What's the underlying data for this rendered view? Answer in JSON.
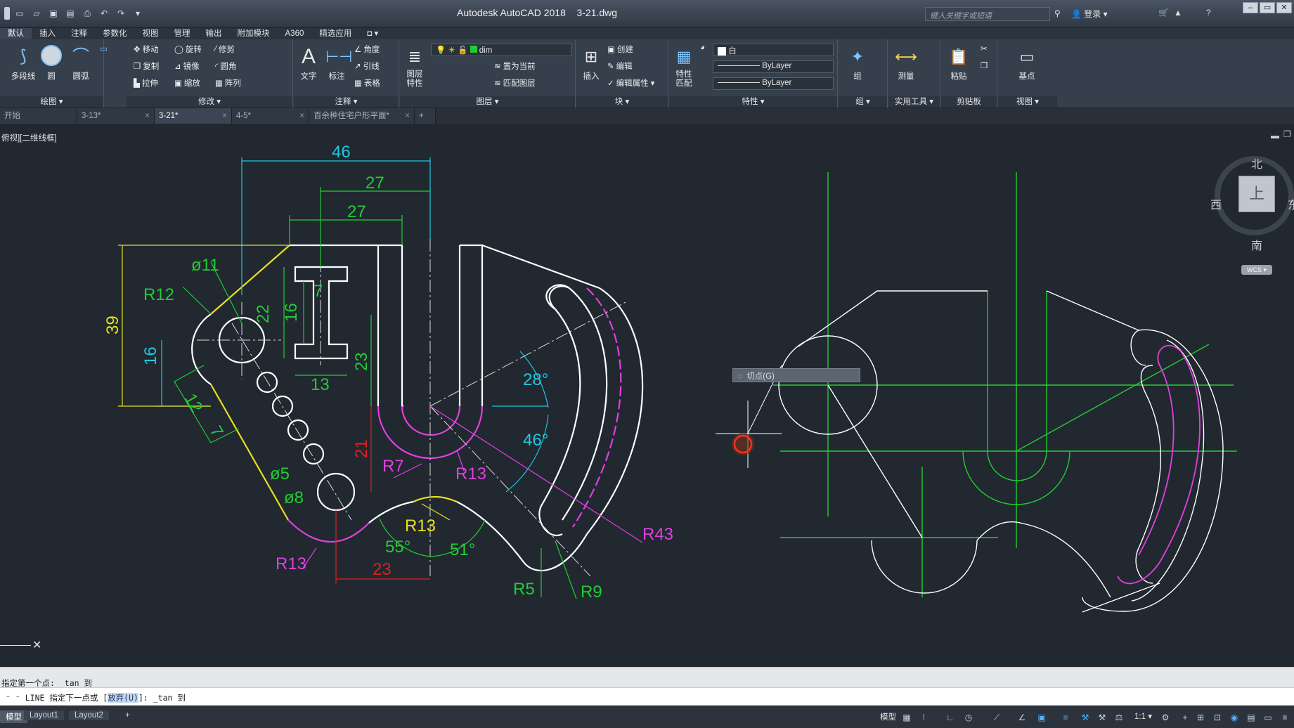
{
  "app": {
    "title": "Autodesk AutoCAD 2018",
    "filename": "3-21.dwg",
    "search_placeholder": "键入关键字或短语",
    "login": "登录"
  },
  "ribbon_tabs": [
    "默认",
    "插入",
    "注释",
    "参数化",
    "视图",
    "管理",
    "输出",
    "附加模块",
    "A360",
    "精选应用"
  ],
  "ribbon": {
    "draw": {
      "title": "绘图",
      "polyline": "多段线",
      "circle": "圆",
      "arc": "圆弧"
    },
    "modify": {
      "title": "修改",
      "move": "移动",
      "rotate": "旋转",
      "trim": "修剪",
      "copy": "复制",
      "mirror": "镜像",
      "fillet": "圆角",
      "stretch": "拉伸",
      "scale": "缩放",
      "array": "阵列"
    },
    "annotation": {
      "title": "注释",
      "text": "文字",
      "dimension": "标注",
      "angle": "角度",
      "leader": "引线",
      "table": "表格"
    },
    "layers": {
      "title": "图层",
      "properties": "图层\n特性",
      "current_layer": "dim",
      "make_current": "置为当前",
      "match_layer": "匹配图层"
    },
    "block": {
      "title": "块",
      "insert": "插入",
      "create": "创建",
      "edit": "编辑",
      "edit_attr": "编辑属性"
    },
    "properties": {
      "title": "特性",
      "match": "特性\n匹配",
      "color": "白",
      "linetype": "ByLayer",
      "lineweight": "ByLayer"
    },
    "groups": {
      "title": "组",
      "group": "组"
    },
    "utilities": {
      "title": "实用工具",
      "measure": "测量"
    },
    "clipboard": {
      "title": "剪贴板",
      "paste": "粘贴"
    },
    "view": {
      "title": "视图",
      "base": "基点"
    }
  },
  "doc_tabs": [
    {
      "label": "开始",
      "active": false
    },
    {
      "label": "3-13*",
      "active": false
    },
    {
      "label": "3-21*",
      "active": true
    },
    {
      "label": "4-5*",
      "active": false
    },
    {
      "label": "百余种住宅户形平面*",
      "active": false
    }
  ],
  "viewport_label": "俯视][二维线框]",
  "viewcube": {
    "north": "北",
    "south": "南",
    "west": "西",
    "east": "东",
    "top": "上",
    "wcs": "WCS"
  },
  "snap_tooltip": "切点(G)",
  "dims": {
    "d46": "46",
    "d27a": "27",
    "d27b": "27",
    "d39": "39",
    "d16a": "16",
    "d12": "12",
    "d7a": "7",
    "phi11": "ø11",
    "r12": "R12",
    "d22": "22",
    "d16b": "16",
    "d7b": "7",
    "d13": "13",
    "d23a": "23",
    "d21": "21",
    "r7": "R7",
    "r13a": "R13",
    "a28": "28°",
    "a46": "46°",
    "phi5": "ø5",
    "phi8": "ø8",
    "r13b": "R13",
    "r13c": "R13",
    "a55": "55°",
    "a51": "51°",
    "d23b": "23",
    "r43": "R43",
    "r5": "R5",
    "r9": "R9"
  },
  "command": {
    "history": "指定第一个点: _tan 到",
    "prompt_prefix": "LINE 指定下一点或 [",
    "prompt_opt": "放弃(U)",
    "prompt_suffix": "]: _tan 到"
  },
  "status": {
    "model": "模型",
    "layout1": "Layout1",
    "layout2": "Layout2",
    "scale": "1:1",
    "model_btn": "模型"
  },
  "colors": {
    "background": "#212830",
    "white": "#ffffff",
    "green": "#22cc33",
    "cyan": "#20c8e0",
    "magenta": "#e040e0",
    "yellow": "#e8e020",
    "red": "#e02020"
  }
}
